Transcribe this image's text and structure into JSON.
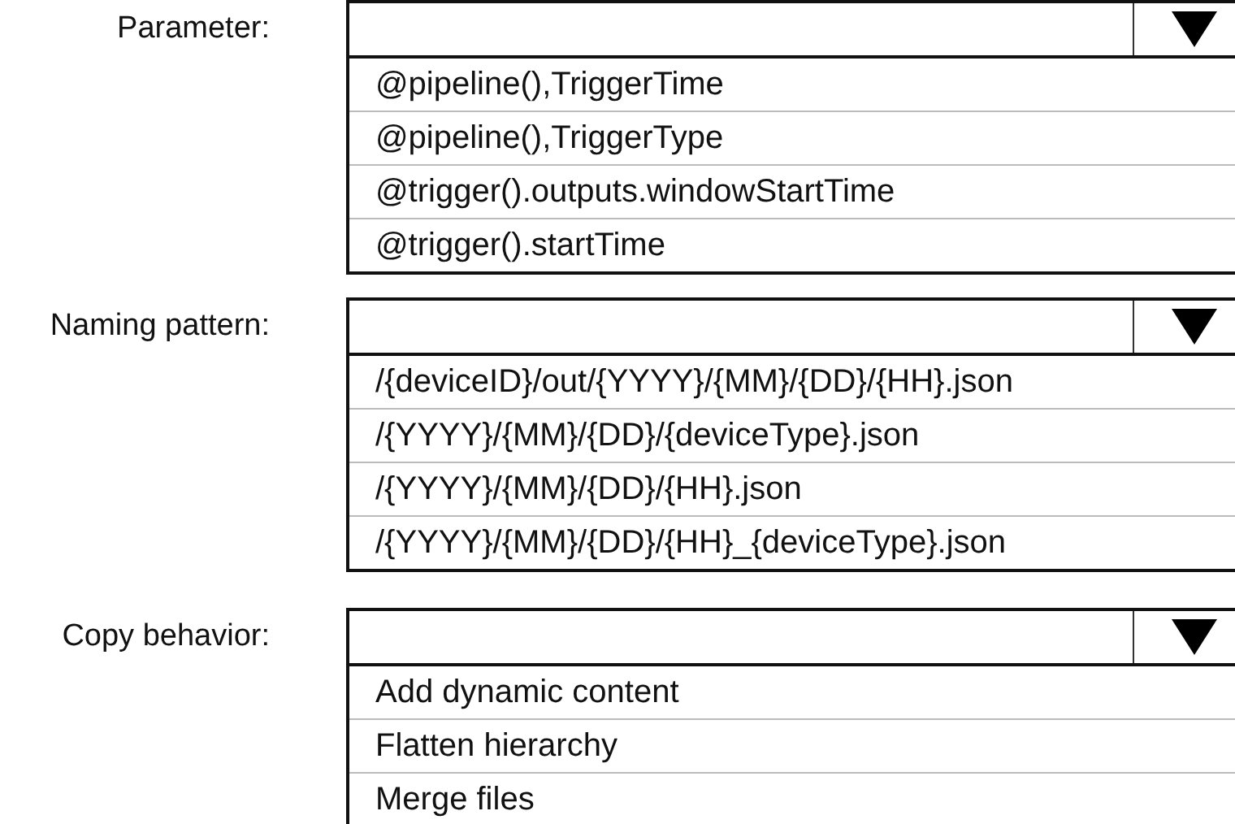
{
  "dropdowns": [
    {
      "label": "Parameter:",
      "options": [
        "@pipeline(),TriggerTime",
        "@pipeline(),TriggerType",
        "@trigger().outputs.windowStartTime",
        "@trigger().startTime"
      ]
    },
    {
      "label": "Naming pattern:",
      "options": [
        "/{deviceID}/out/{YYYY}/{MM}/{DD}/{HH}.json",
        "/{YYYY}/{MM}/{DD}/{deviceType}.json",
        "/{YYYY}/{MM}/{DD}/{HH}.json",
        "/{YYYY}/{MM}/{DD}/{HH}_{deviceType}.json"
      ]
    },
    {
      "label": "Copy behavior:",
      "options": [
        "Add dynamic content",
        "Flatten hierarchy",
        "Merge files"
      ]
    }
  ]
}
